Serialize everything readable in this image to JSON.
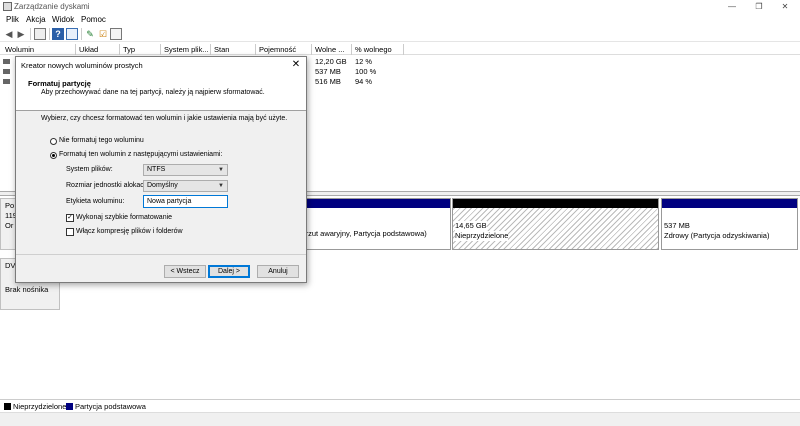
{
  "window": {
    "title": "Zarządzanie dyskami",
    "minimize": "—",
    "maximize": "❐",
    "close": "✕"
  },
  "menu": [
    "Plik",
    "Akcja",
    "Widok",
    "Pomoc"
  ],
  "toolbar_icons": [
    "back-arrow-icon",
    "forward-arrow-icon",
    "console-tree-icon",
    "help-icon",
    "properties-icon",
    "refresh-icon",
    "checklist-icon",
    "list-view-icon"
  ],
  "volumes": {
    "headers": [
      "Wolumin",
      "Układ",
      "Typ",
      "System plik...",
      "Stan",
      "Pojemność",
      "Wolne ...",
      "% wolnego"
    ],
    "rows": [
      {
        "free": "12,20 GB",
        "pct": "12 %"
      },
      {
        "free": "537 MB",
        "pct": "100 %"
      },
      {
        "free": "516 MB",
        "pct": "94 %"
      }
    ]
  },
  "disk0": {
    "label_partial": [
      "Po",
      "119",
      "Or"
    ],
    "partition_basic_text": "ia, Zrzut awaryjny, Partycja podstawowa)",
    "unallocated": {
      "size": "14,65 GB",
      "status": "Nieprzydzielone"
    },
    "recovery": {
      "size": "537 MB",
      "status": "Zdrowy (Partycja odzyskiwania)"
    }
  },
  "dvd": {
    "label_partial": "DV",
    "status": "Brak nośnika"
  },
  "legend": [
    {
      "label": "Nieprzydzielone",
      "color": "#000000"
    },
    {
      "label": "Partycja podstawowa",
      "color": "#000080"
    }
  ],
  "dialog": {
    "title": "Kreator nowych woluminów prostych",
    "close": "✕",
    "header_title": "Formatuj partycję",
    "header_sub": "Aby przechowywać dane na tej partycji, należy ją najpierw sformatować.",
    "intro": "Wybierz, czy chcesz formatować ten wolumin i jakie ustawienia mają być użyte.",
    "opt_noformat": "Nie formatuj tego woluminu",
    "opt_format": "Formatuj ten wolumin z następującymi ustawieniami:",
    "fs_label": "System plików:",
    "fs_value": "NTFS",
    "alloc_label": "Rozmiar jednostki alokacji:",
    "alloc_value": "Domyślny",
    "vol_label_label": "Etykieta woluminu:",
    "vol_label_value": "Nowa partycja",
    "quick_format": "Wykonaj szybkie formatowanie",
    "quick_format_checked": true,
    "compression": "Włącz kompresję plików i folderów",
    "compression_checked": false,
    "btn_back": "< Wstecz",
    "btn_next": "Dalej >",
    "btn_cancel": "Anuluj"
  }
}
